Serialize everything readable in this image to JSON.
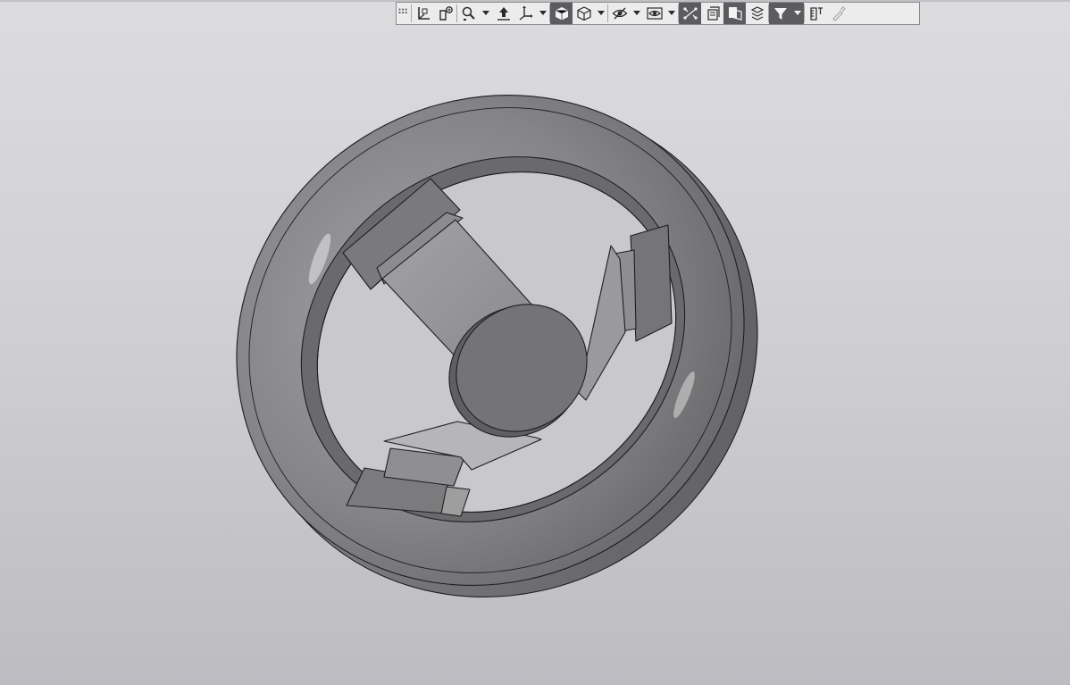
{
  "window": {
    "title": ""
  },
  "viewport": {
    "background_top": "#dcdcde",
    "background_bottom": "#bcbcc1",
    "model_name": "steering wheel",
    "model_color": "#7d7d7f"
  },
  "toolbar": {
    "groups": [
      [
        "grip-icon"
      ],
      [
        "orientation-icon",
        "normal-to-icon"
      ],
      [
        "zoom-icon",
        "dropdown-icon",
        "rotate-icon",
        "pan-axes-icon",
        "dropdown-icon"
      ],
      [
        "shaded-view-icon",
        "wireframe-view-icon",
        "dropdown-icon"
      ],
      [
        "hide-icon",
        "dropdown-icon",
        "show-icon",
        "dropdown-icon"
      ],
      [
        "constraints-icon",
        "section-icon",
        "perspective-icon",
        "layers-icon"
      ],
      [
        "filter-icon",
        "dropdown-icon"
      ],
      [
        "measure-icon",
        "eyedropper-icon"
      ]
    ],
    "active": [
      "shaded-view-icon",
      "constraints-icon",
      "perspective-icon",
      "filter-icon"
    ],
    "disabled": [
      "eyedropper-icon"
    ]
  }
}
